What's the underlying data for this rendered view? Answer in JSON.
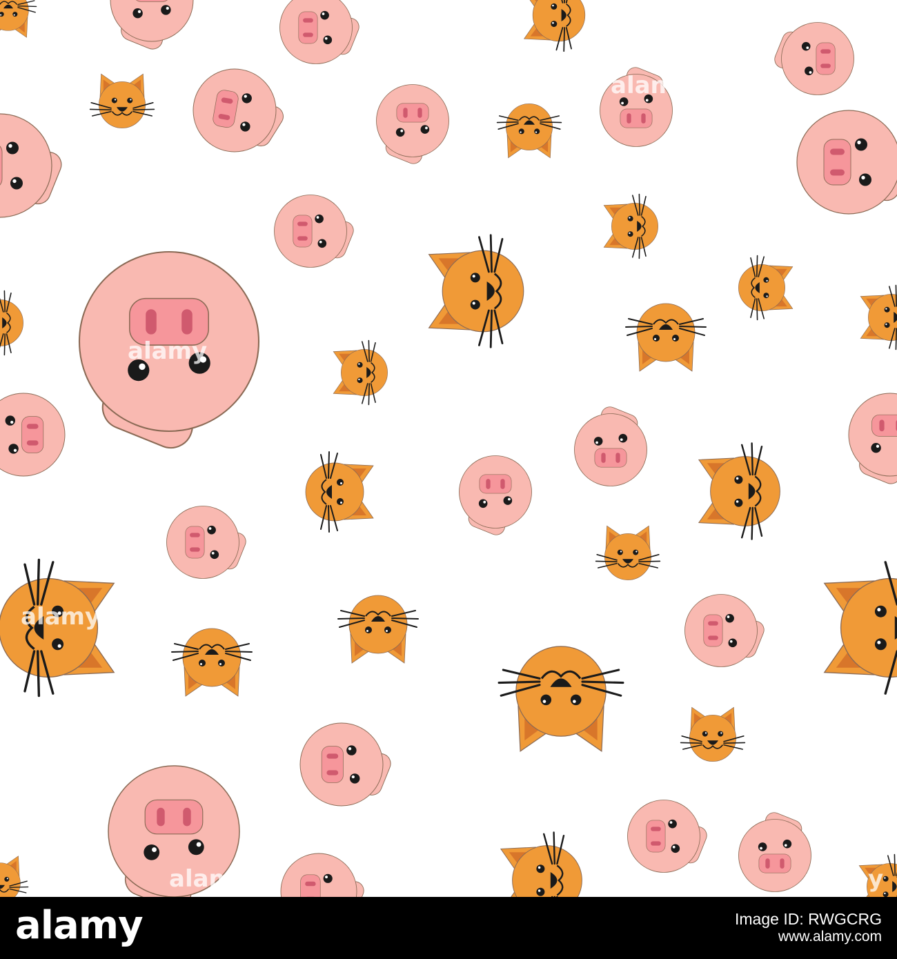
{
  "watermark": "alamy",
  "colors": {
    "background": "#ffffff",
    "pig_skin": "#f9b9b1",
    "pig_snout": "#f6969b",
    "pig_nostril": "#d05a6e",
    "cat_fur": "#f09a37",
    "cat_ear_inner": "#d8762a",
    "feature": "#1a1a1a",
    "outline": "#8a6a55",
    "footer": "#000000",
    "footer_text": "#ffffff"
  },
  "footer": {
    "logo": "alamy",
    "image_id": "Image ID: RWGCRG",
    "site": "www.alamy.com"
  }
}
